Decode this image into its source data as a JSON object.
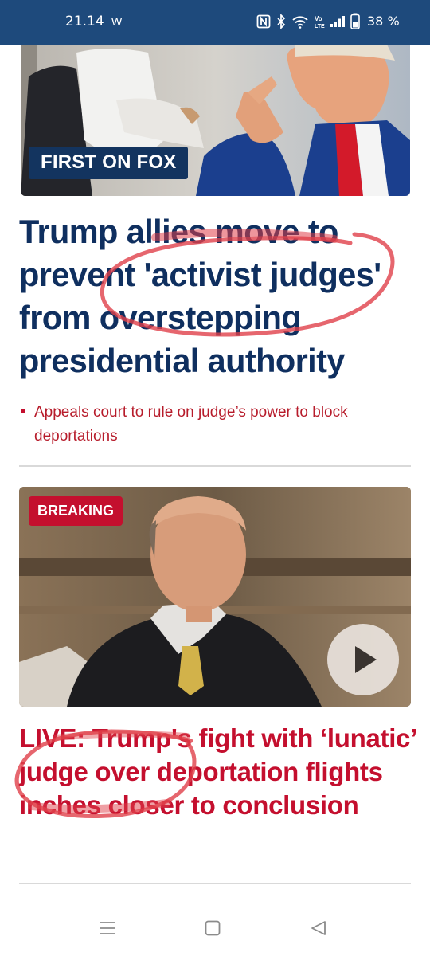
{
  "status_bar": {
    "time": "21.14",
    "carrier_icon": "W",
    "battery_pct": "38 %",
    "icons": [
      "nfc-icon",
      "bluetooth-icon",
      "wifi-icon",
      "volte-icon",
      "signal-icon",
      "battery-icon"
    ]
  },
  "story1": {
    "tag": "FIRST ON FOX",
    "headline": "Trump allies move to prevent 'activist judges' from overstepping presidential authority",
    "bullet": "Appeals court to rule on judge’s power to block deportations"
  },
  "story2": {
    "tag": "BREAKING",
    "headline": "LIVE: Trump's fight with ‘lunatic’ judge over deportation flights inches closer to conclusion"
  },
  "nav": {
    "icons": [
      "recents-icon",
      "home-icon",
      "back-icon"
    ]
  },
  "colors": {
    "status_bar": "#1e4a7c",
    "headline_navy": "#0f2f5f",
    "accent_red": "#c40f2e",
    "annotation": "#e0404a"
  }
}
